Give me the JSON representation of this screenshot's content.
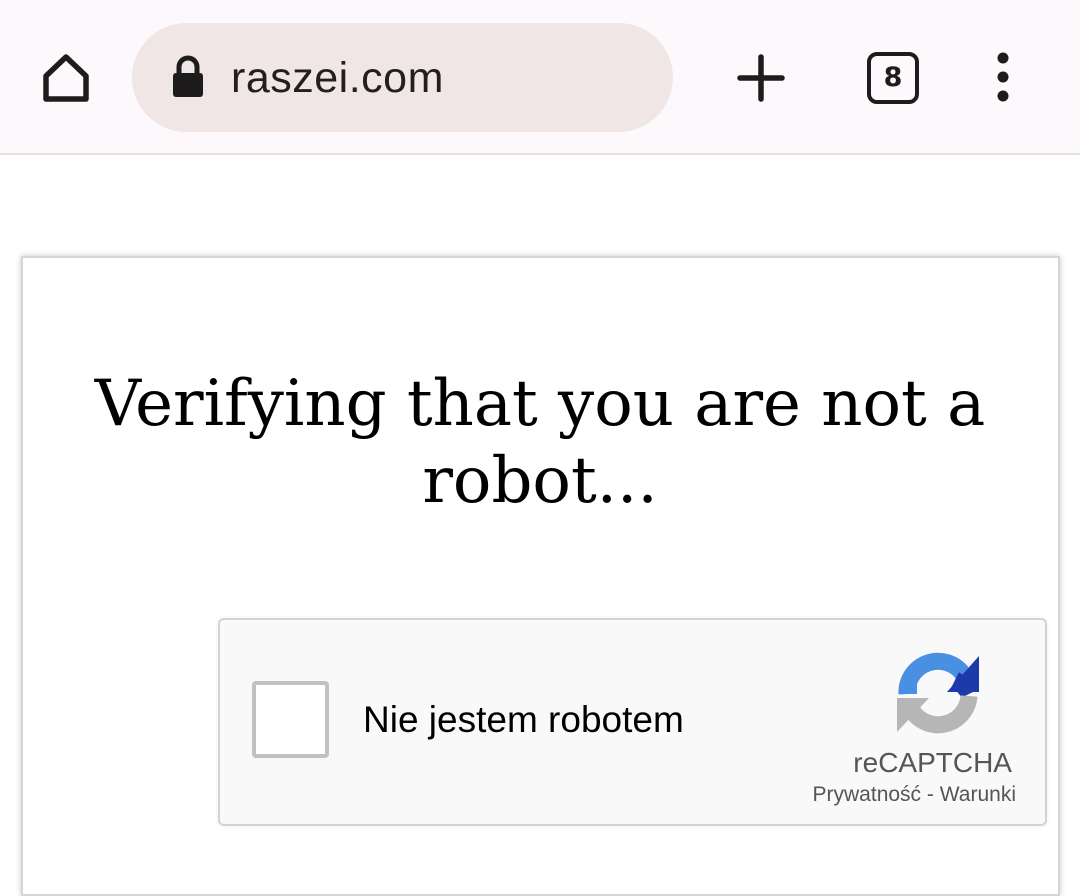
{
  "browser": {
    "url": "raszei.com",
    "tab_count": "8",
    "icons": {
      "home": "home-icon",
      "lock": "lock-icon",
      "new_tab": "plus-icon",
      "tabs": "tab-switcher-icon",
      "menu": "more-vert-icon"
    }
  },
  "page": {
    "heading": "Verifying that you are not a robot..."
  },
  "recaptcha": {
    "checkbox_label": "Nie jestem robotem",
    "brand": "reCAPTCHA",
    "privacy_link": "Prywatność",
    "separator": "-",
    "terms_link": "Warunki",
    "checked": false,
    "colors": {
      "blue": "#4a90e2",
      "dark_blue": "#1c3aa9",
      "gray": "#b6b6b6"
    }
  }
}
